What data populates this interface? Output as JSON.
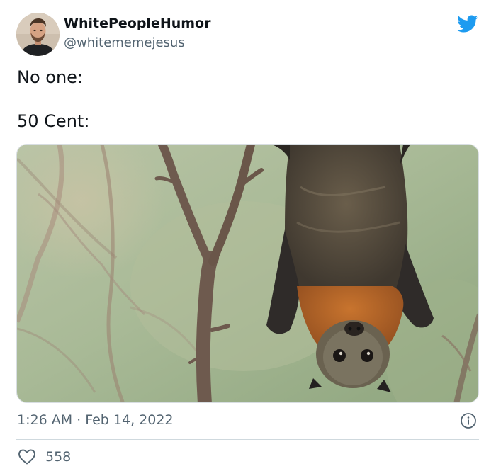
{
  "author": {
    "display_name": "WhitePeopleHumor",
    "handle": "@whitememejesus"
  },
  "tweet": {
    "lines": [
      "No one:",
      "50 Cent:"
    ]
  },
  "meta": {
    "timestamp": "1:26 AM · Feb 14, 2022",
    "likes": "558"
  },
  "icons": {
    "brand": "twitter-bird-icon",
    "info": "info-icon",
    "like": "heart-icon"
  },
  "colors": {
    "brand": "#1d9bf0",
    "text": "#0f1419",
    "secondary": "#536471",
    "divider": "#cfd9de"
  }
}
